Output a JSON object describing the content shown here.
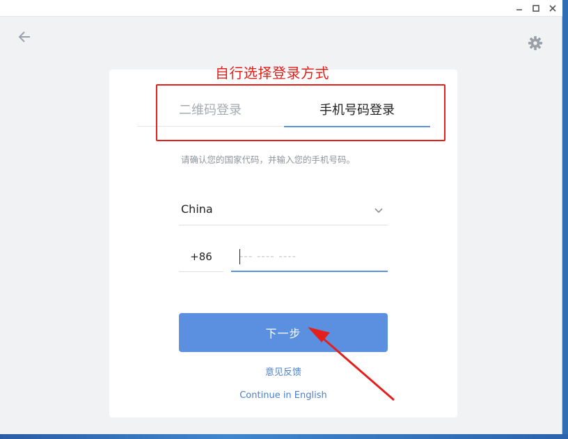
{
  "window": {
    "controls": {
      "minimize_icon": "minimize-icon",
      "maximize_icon": "maximize-icon",
      "close_icon": "close-icon"
    }
  },
  "nav": {
    "back_icon": "arrow-left-icon",
    "settings_icon": "gear-icon"
  },
  "annotation": {
    "label": "自行选择登录方式",
    "color": "#e3201c"
  },
  "login": {
    "tabs": [
      {
        "label": "二维码登录",
        "active": false
      },
      {
        "label": "手机号码登录",
        "active": true
      }
    ],
    "hint": "请确认您的国家代码，并输入您的手机号码。",
    "country": {
      "value": "China"
    },
    "country_code": "+86",
    "phone": {
      "value": "",
      "placeholder": "--- ---- ----"
    },
    "next_button": "下一步",
    "feedback_link": "意见反馈",
    "english_link": "Continue in English"
  },
  "colors": {
    "accent": "#5b8fdf",
    "link": "#4a7fc9",
    "annotation": "#e3201c"
  }
}
